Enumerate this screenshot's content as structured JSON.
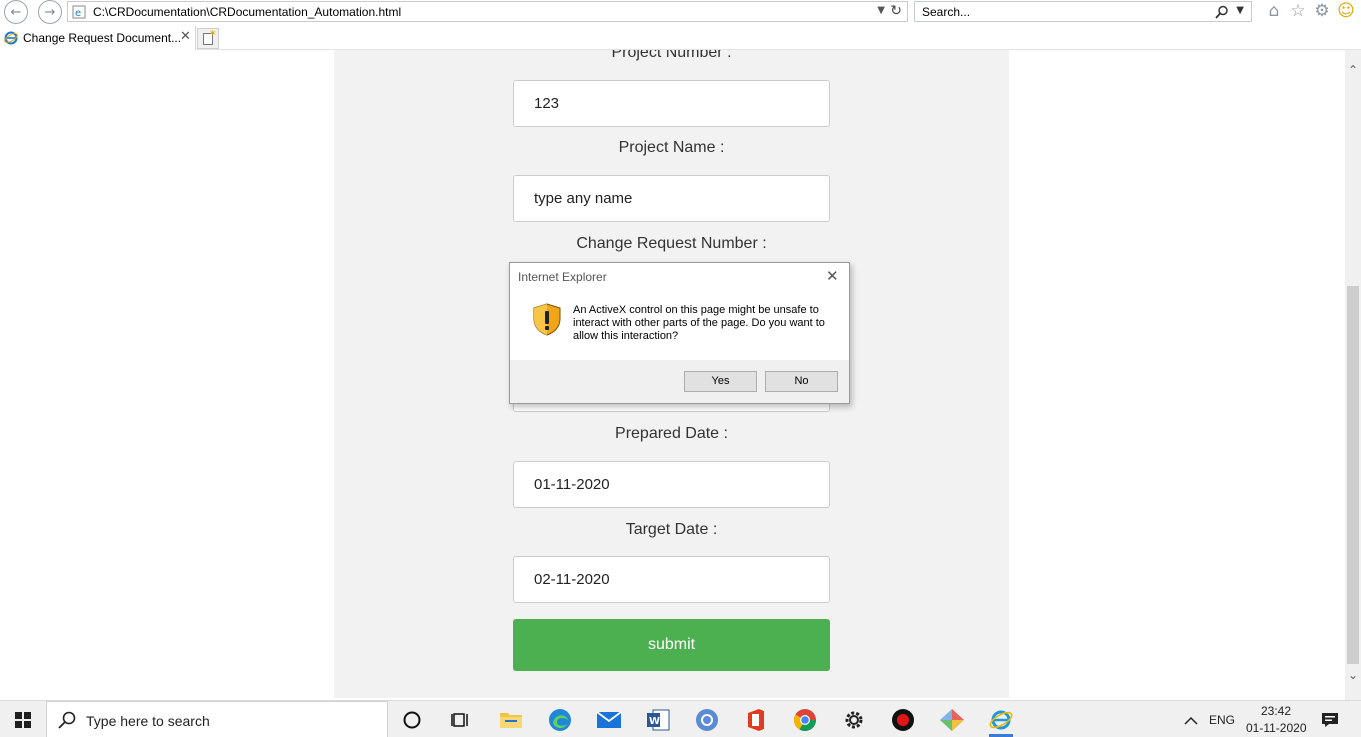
{
  "browser": {
    "address": "C:\\CRDocumentation\\CRDocumentation_Automation.html",
    "search_placeholder": "Search...",
    "tab_title": "Change Request Document...",
    "icons": [
      "back-icon",
      "forward-icon",
      "refresh-icon",
      "search-icon",
      "home-icon",
      "favorites-star-icon",
      "settings-gear-icon",
      "smiley-feedback-icon"
    ]
  },
  "form": {
    "project_number_label": "Project Number :",
    "project_number_value": "123",
    "project_name_label": "Project Name :",
    "project_name_value": "type any name",
    "cr_number_label": "Change Request Number :",
    "prepared_date_label": "Prepared Date :",
    "prepared_date_value": "01-11-2020",
    "target_date_label": "Target Date :",
    "target_date_value": "02-11-2020",
    "submit_label": "submit"
  },
  "dialog": {
    "title": "Internet Explorer",
    "message": "An ActiveX control on this page might be unsafe to interact with other parts of the page. Do you want to allow this interaction?",
    "yes_label": "Yes",
    "no_label": "No"
  },
  "taskbar": {
    "search_placeholder": "Type here to search",
    "language": "ENG",
    "time": "23:42",
    "date": "01-11-2020"
  },
  "colors": {
    "submit": "#4caf50",
    "panel": "#f2f2f2"
  }
}
